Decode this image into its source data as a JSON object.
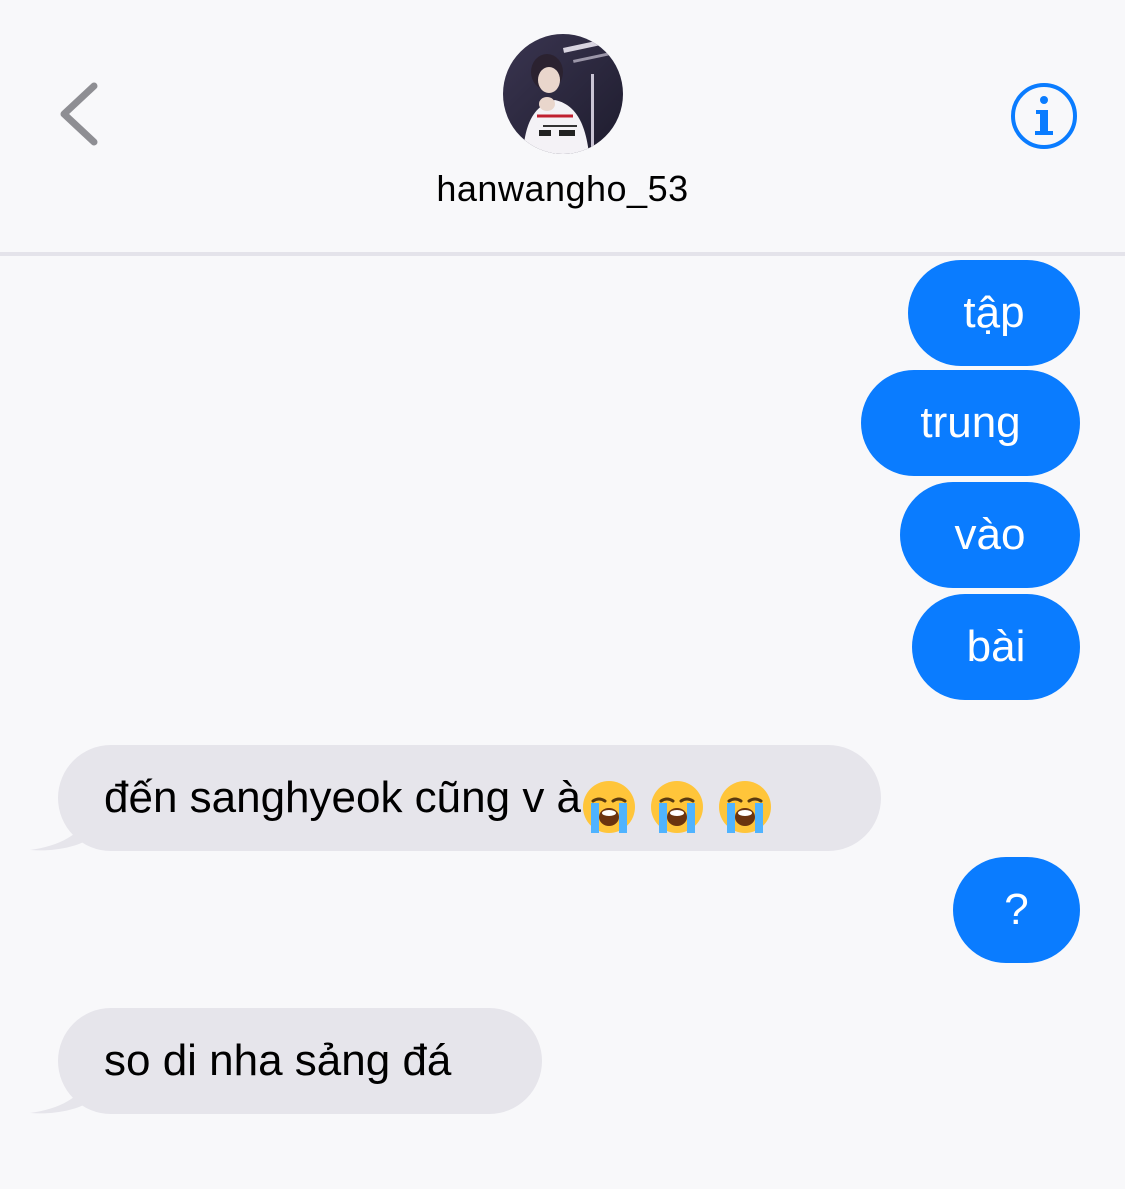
{
  "header": {
    "contact_name": "hanwangho_53",
    "back_icon": "chevron-left-icon",
    "info_icon": "info-circle-icon",
    "accent_color": "#0a7cff"
  },
  "messages": [
    {
      "direction": "outgoing",
      "text": "tập"
    },
    {
      "direction": "outgoing",
      "text": "trung"
    },
    {
      "direction": "outgoing",
      "text": "vào"
    },
    {
      "direction": "outgoing",
      "text": "bài"
    },
    {
      "direction": "incoming",
      "text": "đến sanghyeok cũng v à",
      "emoji": [
        "loudly-crying-face",
        "loudly-crying-face",
        "loudly-crying-face"
      ]
    },
    {
      "direction": "outgoing",
      "text": "?"
    },
    {
      "direction": "incoming",
      "text": "so di nha sảng đá"
    }
  ],
  "colors": {
    "outgoing_bubble": "#0a7cff",
    "incoming_bubble": "#e6e5eb",
    "background": "#f8f8fa"
  }
}
